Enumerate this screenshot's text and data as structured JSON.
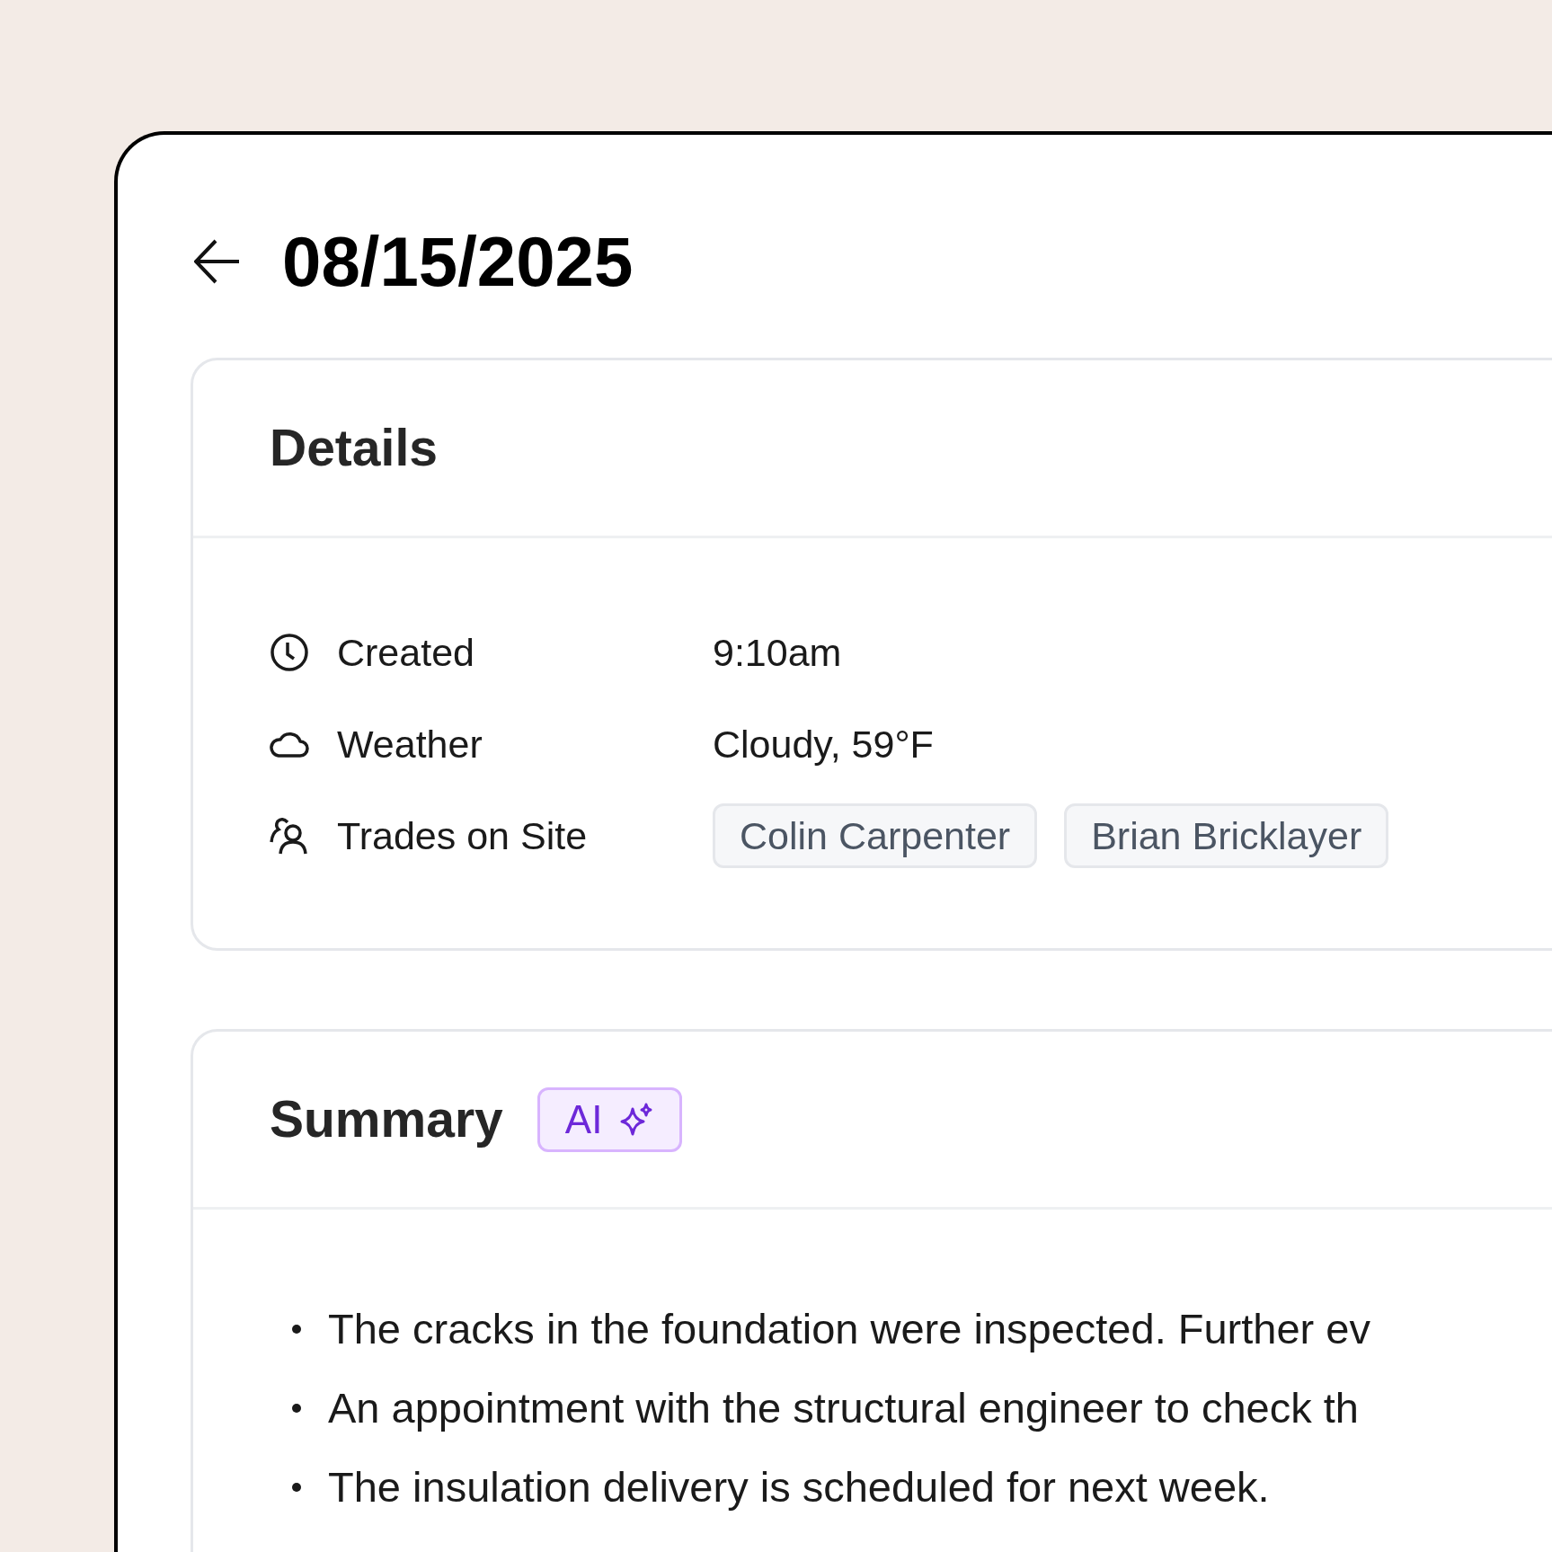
{
  "header": {
    "title": "08/15/2025"
  },
  "details": {
    "title": "Details",
    "rows": [
      {
        "kind": "created",
        "label": "Created",
        "value": "9:10am"
      },
      {
        "kind": "weather",
        "label": "Weather",
        "value": "Cloudy, 59°F"
      },
      {
        "kind": "trades",
        "label": "Trades on Site",
        "chips": [
          "Colin Carpenter",
          "Brian Bricklayer"
        ]
      }
    ]
  },
  "summary": {
    "title": "Summary",
    "badge": "AI",
    "bullets": [
      "The cracks in the foundation were inspected. Further ev",
      "An appointment with the structural engineer to check th",
      "The insulation delivery is scheduled for next week."
    ]
  }
}
